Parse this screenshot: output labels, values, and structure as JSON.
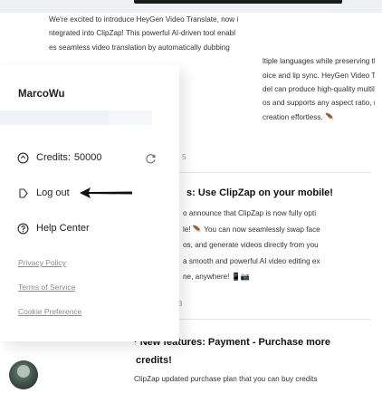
{
  "feed": {
    "news1_lines": [
      "We're excited to introduce HeyGen Video Translate, now i",
      "ntegrated into ClipZap! This powerful AI-driven tool enabl",
      "es seamless video translation by automatically dubbing",
      "ltiple languages while preserving the origi",
      "oice and lip sync. HeyGen Video Translate",
      "del can produce high-quality multilingual",
      "os and supports any aspect ratio, making",
      "creation effortless. 🪶"
    ],
    "news1_num": "5",
    "news2_title": "s: Use ClipZap on your mobile!",
    "news2_lines": [
      "o announce that ClipZap is now fully opti",
      "le! 🪶 You can now seamlessly swap face",
      "os, and generate videos directly from you",
      "a smooth and powerful AI video editing ex",
      "ne, anywhere! 📱📷"
    ],
    "news2_num": "3",
    "news3_title": "· New features: Payment - Purchase more",
    "news3_title2": "credits!",
    "news3_line": "ClipZap updated purchase plan that you can buy credits"
  },
  "menu": {
    "user_name": "MarcoWu",
    "credits_label": "Credits:",
    "credits_value": "50000",
    "logout_label": "Log out",
    "help_label": "Help Center",
    "privacy_label": "Privacy Policy",
    "terms_label": "Terms of Service",
    "cookie_label": "Cookie Preference"
  },
  "icons": {
    "credits": "coin-icon",
    "refresh": "refresh-icon",
    "logout": "logout-icon",
    "help": "help-icon",
    "annotation": "arrow-annotation"
  }
}
